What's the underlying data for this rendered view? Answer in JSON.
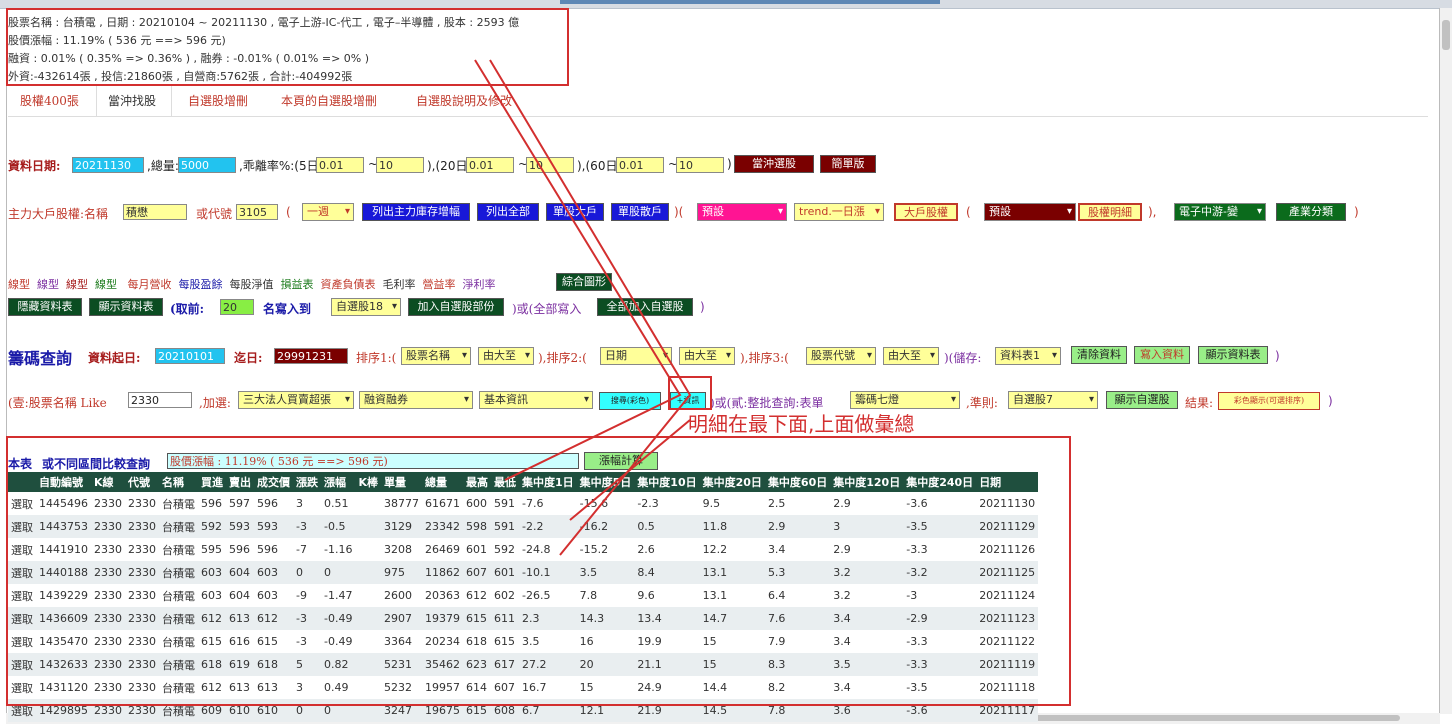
{
  "info": {
    "line1": "股票名稱 : 台積電 , 日期 : 20210104 ~ 20211130 , 電子上游-IC-代工 , 電子–半導體 , 股本 : 2593 億",
    "line2": "股價漲幅 : 11.19% ( 536 元 ==> 596 元)",
    "line3": "融資 : 0.01% ( 0.35% => 0.36% ) , 融券 : -0.01% ( 0.01% => 0% )",
    "line4": "外資:-432614張 , 投信:21860張 , 自營商:5762張 , 合計:-404992張"
  },
  "tabs": [
    "股權400張",
    "當沖找股",
    "自選股增刪",
    "本頁的自選股增刪",
    "自選股說明及修改"
  ],
  "row1": {
    "date_label": "資料日期:",
    "date": "20211130",
    "vol_label": ",總量:",
    "vol": "5000",
    "dev_label": ",乖離率%:(5日:",
    "d5a": "0.01",
    "tilde": "~",
    "d5b": "10",
    "d20_label": "),(20日:",
    "d20a": "0.01",
    "d20b": "10",
    "d60_label": "),(60日:",
    "d60a": "0.01",
    "d60b": "10",
    "close": ")",
    "btn_daytrade": "當沖選股",
    "btn_simple": "簡單版"
  },
  "row2": {
    "label": "主力大戶股權:名稱",
    "name": "積懋",
    "code_label": "或代號",
    "code": "3105",
    "paren": "(",
    "sel_week": "一週",
    "btn_list_main": "列出主力庫存增幅",
    "btn_list_all": "列出全部",
    "btn_big": "單股大戶",
    "btn_retail": "單股散戶",
    "paren2": ")(",
    "sel_default": "預設",
    "sel_trend": "trend.一日漲",
    "btn_holders": "大戶股權",
    "paren3": "(",
    "sel_default2": "預設",
    "btn_detail": "股權明細",
    "paren4": "),",
    "sel_industry": "電子中游-變",
    "btn_industry": "產業分類",
    "paren5": ")"
  },
  "links": [
    "線型",
    "線型",
    "線型",
    "線型",
    "每月營收",
    "每股盈餘",
    "每股淨值",
    "損益表",
    "資產負債表",
    "毛利率",
    "營益率",
    "淨利率"
  ],
  "btn_combo": "綜合圖形",
  "row4": {
    "btn_hide": "隱藏資料表",
    "btn_show": "顯示資料表",
    "take_label": "(取前:",
    "take": "20",
    "write_label": "名寫入到",
    "sel_list": "自選股18",
    "btn_add_part": "加入自選股部份",
    "or_all": ")或(全部寫入",
    "btn_add_all": "全部加入自選股",
    "close": ")"
  },
  "row5": {
    "title": "籌碼查詢",
    "start_label": "資料起日:",
    "start": "20210101",
    "end_label": "迄日:",
    "end": "29991231",
    "sort1_label": "排序1:(",
    "sort1": "股票名稱",
    "order1": "由大至",
    "sort2_label": "),排序2:(",
    "sort2": "日期",
    "order2": "由大至",
    "sort3_label": "),排序3:(",
    "sort3": "股票代號",
    "order3": "由大至",
    "save_label": ")(儲存:",
    "save": "資料表1",
    "btn_clear": "清除資料",
    "btn_write": "寫入資料",
    "btn_show": "顯示資料表",
    "close": ")"
  },
  "row6": {
    "label": "(壹:股票名稱 Like",
    "code": "2330",
    "add_label": ",加選:",
    "sel_a": "三大法人買賣超張",
    "sel_b": "融資融券",
    "sel_c": "基本資訊",
    "btn_search": "搜尋(彩色)",
    "btn_info": "+資訊",
    "or_label": ")或(貳:整批查詢:表單",
    "sel_form": "籌碼七燈",
    "rule_label": ",準則:",
    "sel_rule": "自選股7",
    "btn_show_sel": "顯示自選股",
    "result_label": "結果:",
    "btn_result": "彩色顯示(可選排序)",
    "close": ")"
  },
  "annotation": "明細在最下面,上面做彙總",
  "summary": {
    "label1": "本表",
    "label2": "或不同區間比較查詢",
    "value": "股價漲幅 : 11.19% ( 536 元 ==> 596 元)",
    "btn": "漲幅計算"
  },
  "table": {
    "headers": [
      "",
      "自動編號",
      "K線",
      "代號",
      "名稱",
      "買進",
      "賣出",
      "成交價",
      "漲跌",
      "漲幅",
      "K棒",
      "單量",
      "總量",
      "最高",
      "最低",
      "集中度1日",
      "集中度5日",
      "集中度10日",
      "集中度20日",
      "集中度60日",
      "集中度120日",
      "集中度240日",
      "日期"
    ],
    "rows": [
      [
        "選取",
        "1445496",
        "2330",
        "2330",
        "台積電",
        "596",
        "597",
        "596",
        "3",
        "0.51",
        "",
        "38777",
        "61671",
        "600",
        "591",
        "-7.6",
        "-15.6",
        "-2.3",
        "9.5",
        "2.5",
        "2.9",
        "-3.6",
        "20211130"
      ],
      [
        "選取",
        "1443753",
        "2330",
        "2330",
        "台積電",
        "592",
        "593",
        "593",
        "-3",
        "-0.5",
        "",
        "3129",
        "23342",
        "598",
        "591",
        "-2.2",
        "-16.2",
        "0.5",
        "11.8",
        "2.9",
        "3",
        "-3.5",
        "20211129"
      ],
      [
        "選取",
        "1441910",
        "2330",
        "2330",
        "台積電",
        "595",
        "596",
        "596",
        "-7",
        "-1.16",
        "",
        "3208",
        "26469",
        "601",
        "592",
        "-24.8",
        "-15.2",
        "2.6",
        "12.2",
        "3.4",
        "2.9",
        "-3.3",
        "20211126"
      ],
      [
        "選取",
        "1440188",
        "2330",
        "2330",
        "台積電",
        "603",
        "604",
        "603",
        "0",
        "0",
        "",
        "975",
        "11862",
        "607",
        "601",
        "-10.1",
        "3.5",
        "8.4",
        "13.1",
        "5.3",
        "3.2",
        "-3.2",
        "20211125"
      ],
      [
        "選取",
        "1439229",
        "2330",
        "2330",
        "台積電",
        "603",
        "604",
        "603",
        "-9",
        "-1.47",
        "",
        "2600",
        "20363",
        "612",
        "602",
        "-26.5",
        "7.8",
        "9.6",
        "13.1",
        "6.4",
        "3.2",
        "-3",
        "20211124"
      ],
      [
        "選取",
        "1436609",
        "2330",
        "2330",
        "台積電",
        "612",
        "613",
        "612",
        "-3",
        "-0.49",
        "",
        "2907",
        "19379",
        "615",
        "611",
        "2.3",
        "14.3",
        "13.4",
        "14.7",
        "7.6",
        "3.4",
        "-2.9",
        "20211123"
      ],
      [
        "選取",
        "1435470",
        "2330",
        "2330",
        "台積電",
        "615",
        "616",
        "615",
        "-3",
        "-0.49",
        "",
        "3364",
        "20234",
        "618",
        "615",
        "3.5",
        "16",
        "19.9",
        "15",
        "7.9",
        "3.4",
        "-3.3",
        "20211122"
      ],
      [
        "選取",
        "1432633",
        "2330",
        "2330",
        "台積電",
        "618",
        "619",
        "618",
        "5",
        "0.82",
        "",
        "5231",
        "35462",
        "623",
        "617",
        "27.2",
        "20",
        "21.1",
        "15",
        "8.3",
        "3.5",
        "-3.3",
        "20211119"
      ],
      [
        "選取",
        "1431120",
        "2330",
        "2330",
        "台積電",
        "612",
        "613",
        "613",
        "3",
        "0.49",
        "",
        "5232",
        "19957",
        "614",
        "607",
        "16.7",
        "15",
        "24.9",
        "14.4",
        "8.2",
        "3.4",
        "-3.5",
        "20211118"
      ],
      [
        "選取",
        "1429895",
        "2330",
        "2330",
        "台積電",
        "609",
        "610",
        "610",
        "0",
        "0",
        "",
        "3247",
        "19675",
        "615",
        "608",
        "6.7",
        "12.1",
        "21.9",
        "14.5",
        "7.8",
        "3.6",
        "-3.6",
        "20211117"
      ]
    ]
  }
}
